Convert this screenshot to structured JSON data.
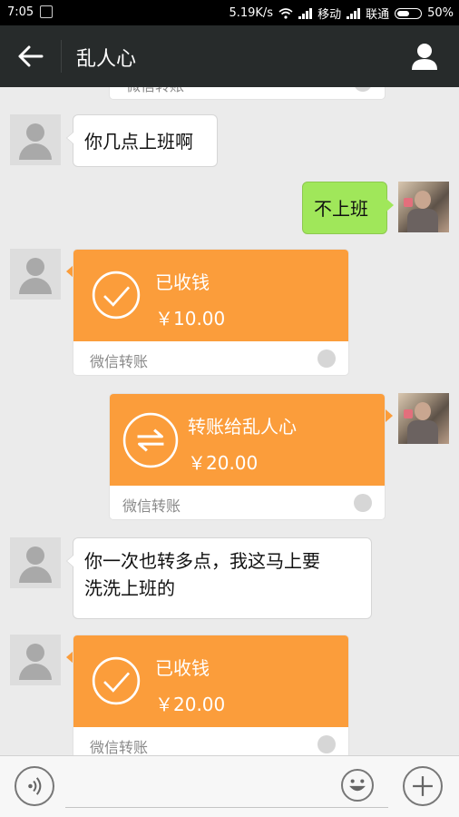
{
  "status_bar": {
    "time": "7:05",
    "speed": "5.19K/s",
    "carrier1": "移动",
    "carrier2": "联通",
    "battery": "50%"
  },
  "header": {
    "title": "乱人心"
  },
  "messages": [
    {
      "type": "transfer-partial",
      "side": "left",
      "footer": "微信转账"
    },
    {
      "type": "text",
      "side": "left",
      "text": "你几点上班啊"
    },
    {
      "type": "text",
      "side": "right",
      "text": "不上班"
    },
    {
      "type": "transfer",
      "side": "left",
      "title": "已收钱",
      "amount": "￥10.00",
      "footer": "微信转账"
    },
    {
      "type": "transfer",
      "side": "right",
      "title": "转账给乱人心",
      "amount": "￥20.00",
      "footer": "微信转账"
    },
    {
      "type": "text",
      "side": "left",
      "text_line1": "你一次也转多点，我这马上要",
      "text_line2": "洗洗上班的"
    },
    {
      "type": "transfer",
      "side": "left",
      "title": "已收钱",
      "amount": "￥20.00",
      "footer": "微信转账"
    }
  ],
  "colors": {
    "transfer_orange": "#fb9d3b",
    "own_bubble": "#a0e75a",
    "title_bar": "#272b2b"
  }
}
